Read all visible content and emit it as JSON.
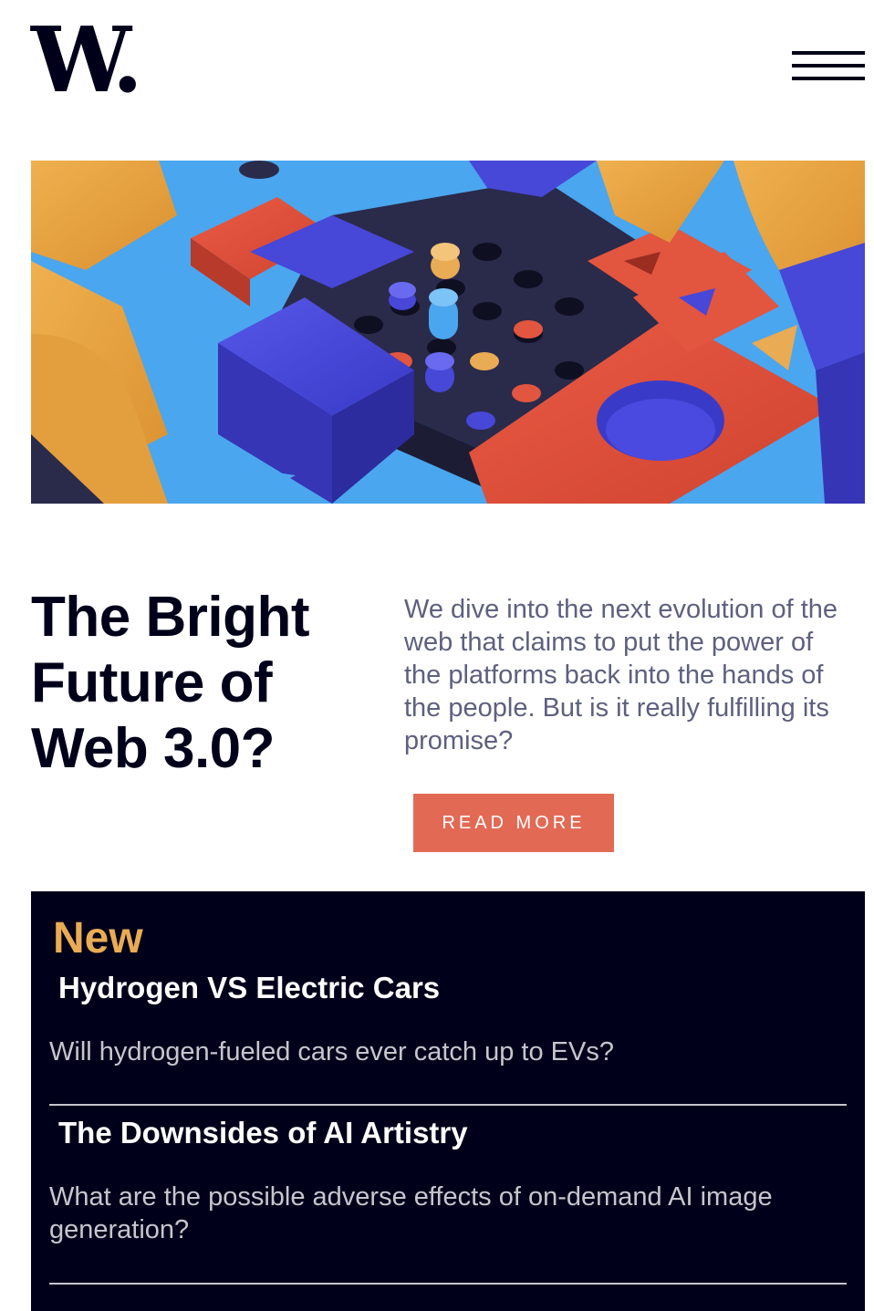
{
  "header": {
    "logo_text": "W.",
    "menu_icon": "hamburger-menu-icon"
  },
  "hero": {
    "image_description_icon": "abstract-blocks-image"
  },
  "main": {
    "headline": "The Bright Future of Web 3.0?",
    "intro": "We dive into the next evolution of the web that claims to put the power of the platforms back into the hands of the people. But is it really fulfilling its promise?",
    "read_more_label": "READ MORE"
  },
  "new_section": {
    "title": "New",
    "articles": [
      {
        "title": "Hydrogen VS Electric Cars",
        "description": "Will hydrogen-fueled cars ever catch up to EVs?"
      },
      {
        "title": "The Downsides of AI Artistry",
        "description": "What are the possible adverse effects of on-demand AI image generation?"
      }
    ]
  },
  "colors": {
    "navy": "#00001a",
    "accent_red": "#e26a55",
    "accent_orange": "#e9ab53",
    "grayish_blue": "#5e607e",
    "light_gray": "#c5c6ce"
  }
}
